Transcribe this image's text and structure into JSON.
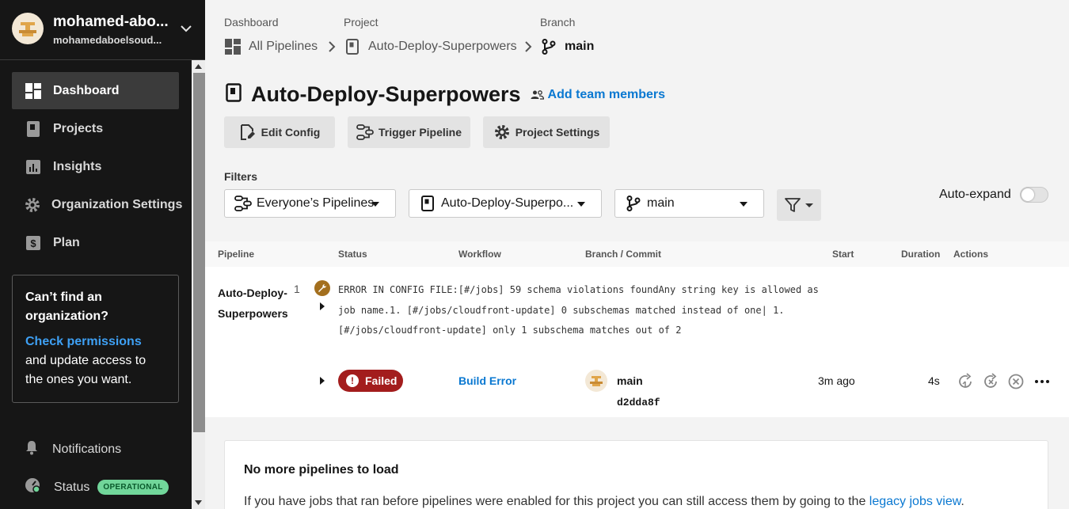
{
  "user": {
    "name": "mohamed-abo...",
    "handle": "mohamedaboelsoud..."
  },
  "nav": {
    "items": [
      {
        "label": "Dashboard",
        "icon": "dashboard-icon"
      },
      {
        "label": "Projects",
        "icon": "projects-icon"
      },
      {
        "label": "Insights",
        "icon": "insights-icon"
      },
      {
        "label": "Organization Settings",
        "icon": "gear-icon"
      },
      {
        "label": "Plan",
        "icon": "dollar-icon"
      }
    ]
  },
  "org_card": {
    "title": "Can’t find an organization?",
    "link": "Check permissions",
    "text": " and update access to the ones you want."
  },
  "bottom": {
    "notifications": "Notifications",
    "status": "Status",
    "status_badge": "OPERATIONAL"
  },
  "breadcrumb": {
    "dashboard_head": "Dashboard",
    "project_head": "Project",
    "branch_head": "Branch",
    "all_pipelines": "All Pipelines",
    "project": "Auto-Deploy-Superpowers",
    "branch": "main"
  },
  "project": {
    "title": "Auto-Deploy-Superpowers",
    "add_members": "Add team members"
  },
  "buttons": {
    "edit_config": "Edit Config",
    "trigger_pipeline": "Trigger Pipeline",
    "project_settings": "Project Settings"
  },
  "filters": {
    "label": "Filters",
    "pipelines": "Everyone’s Pipelines",
    "project": "Auto-Deploy-Superpo...",
    "branch": "main",
    "auto_expand": "Auto-expand"
  },
  "table": {
    "headers": [
      "Pipeline",
      "Status",
      "Workflow",
      "Branch / Commit",
      "Start",
      "Duration",
      "Actions"
    ],
    "row": {
      "pipeline_name": "Auto-Deploy-Superpowers",
      "number": "1",
      "error": "ERROR IN CONFIG FILE:[#/jobs] 59 schema violations foundAny string key is allowed as job name.1. [#/jobs/cloudfront-update] 0 subschemas matched instead of one|   1. [#/jobs/cloudfront-update] only 1 subschema matches out of 2",
      "status": "Failed",
      "workflow": "Build Error",
      "branch": "main",
      "commit": "d2dda8f",
      "start": "3m ago",
      "duration": "4s"
    }
  },
  "load_more": {
    "title": "No more pipelines to load",
    "text": "If you have jobs that ran before pipelines were enabled for this project you can still access them by going to the ",
    "link": "legacy jobs view",
    "suffix": "."
  },
  "colors": {
    "sidebar_bg": "#161616",
    "link": "#0a78d1",
    "failed": "#a31d1d",
    "operational": "#71d69a"
  }
}
